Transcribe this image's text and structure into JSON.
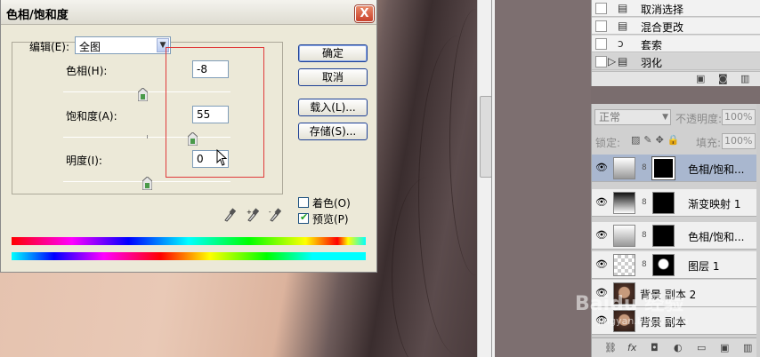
{
  "dialog": {
    "title": "色相/饱和度",
    "close_label": "X",
    "edit_label": "编辑(E):",
    "edit_value": "全图",
    "hue_label": "色相(H):",
    "hue_value": "-8",
    "saturation_label": "饱和度(A):",
    "saturation_value": "55",
    "lightness_label": "明度(I):",
    "lightness_value": "0",
    "sliders": {
      "hue": -8,
      "hue_range": [
        -180,
        180
      ],
      "saturation": 55,
      "saturation_range": [
        -100,
        100
      ],
      "lightness": 0,
      "lightness_range": [
        -100,
        100
      ]
    },
    "buttons": {
      "ok": "确定",
      "cancel": "取消",
      "load": "载入(L)...",
      "save": "存储(S)..."
    },
    "colorize_label": "着色(O)",
    "colorize_checked": false,
    "preview_label": "预览(P)",
    "preview_checked": true
  },
  "history": {
    "items": [
      {
        "label": "取消选择",
        "icon": "document-icon",
        "active": false
      },
      {
        "label": "混合更改",
        "icon": "document-icon",
        "active": false
      },
      {
        "label": "套索",
        "icon": "lasso-icon",
        "active": false
      },
      {
        "label": "羽化",
        "icon": "document-icon",
        "active": true
      }
    ]
  },
  "layers": {
    "blend_mode": "正常",
    "opacity_label": "不透明度:",
    "opacity_value": "100%",
    "lock_label": "锁定:",
    "fill_label": "填充:",
    "fill_value": "100%",
    "items": [
      {
        "name": "色相/饱和...",
        "thumb": "adjustment",
        "mask": "black",
        "selected": true
      },
      {
        "name": "渐变映射 1",
        "thumb": "gradient",
        "mask": "black",
        "selected": false
      },
      {
        "name": "色相/饱和...",
        "thumb": "adjustment",
        "mask": "black",
        "selected": false
      },
      {
        "name": "图层 1",
        "thumb": "transparent",
        "mask": "face",
        "selected": false
      },
      {
        "name": "背景 副本 2",
        "thumb": "photo",
        "mask": "",
        "selected": false
      },
      {
        "name": "背景 副本",
        "thumb": "photo",
        "mask": "",
        "selected": false
      }
    ]
  },
  "watermark": {
    "text": "Baidu 经验",
    "sub": "jingyan.baidu.com"
  }
}
